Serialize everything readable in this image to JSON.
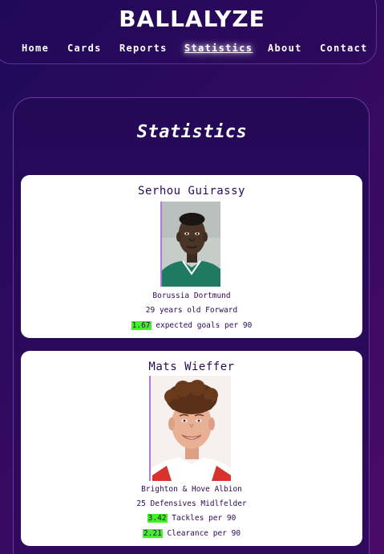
{
  "header": {
    "brand": "BALLALYZE",
    "nav": [
      "Home",
      "Cards",
      "Reports",
      "Statistics",
      "About",
      "Contact"
    ],
    "active": "Statistics"
  },
  "page": {
    "title": "Statistics"
  },
  "players": [
    {
      "name": "Serhou Guirassy",
      "club": "Borussia Dortmund",
      "description": "29 years old Forward",
      "stats": [
        {
          "value": "1.67",
          "label": "expected goals per 90"
        }
      ]
    },
    {
      "name": "Mats Wieffer",
      "club": "Brighton & Hove Albion",
      "description": "25 Defensives Midlfelder",
      "stats": [
        {
          "value": "3.42",
          "label": "Tackles per 90"
        },
        {
          "value": "2.21",
          "label": "Clearance per 90"
        }
      ]
    }
  ],
  "colors": {
    "background": "#320a5e",
    "card": "#ffffff",
    "text_dark": "#2a0a55",
    "stat_highlight": "#44f02a"
  }
}
